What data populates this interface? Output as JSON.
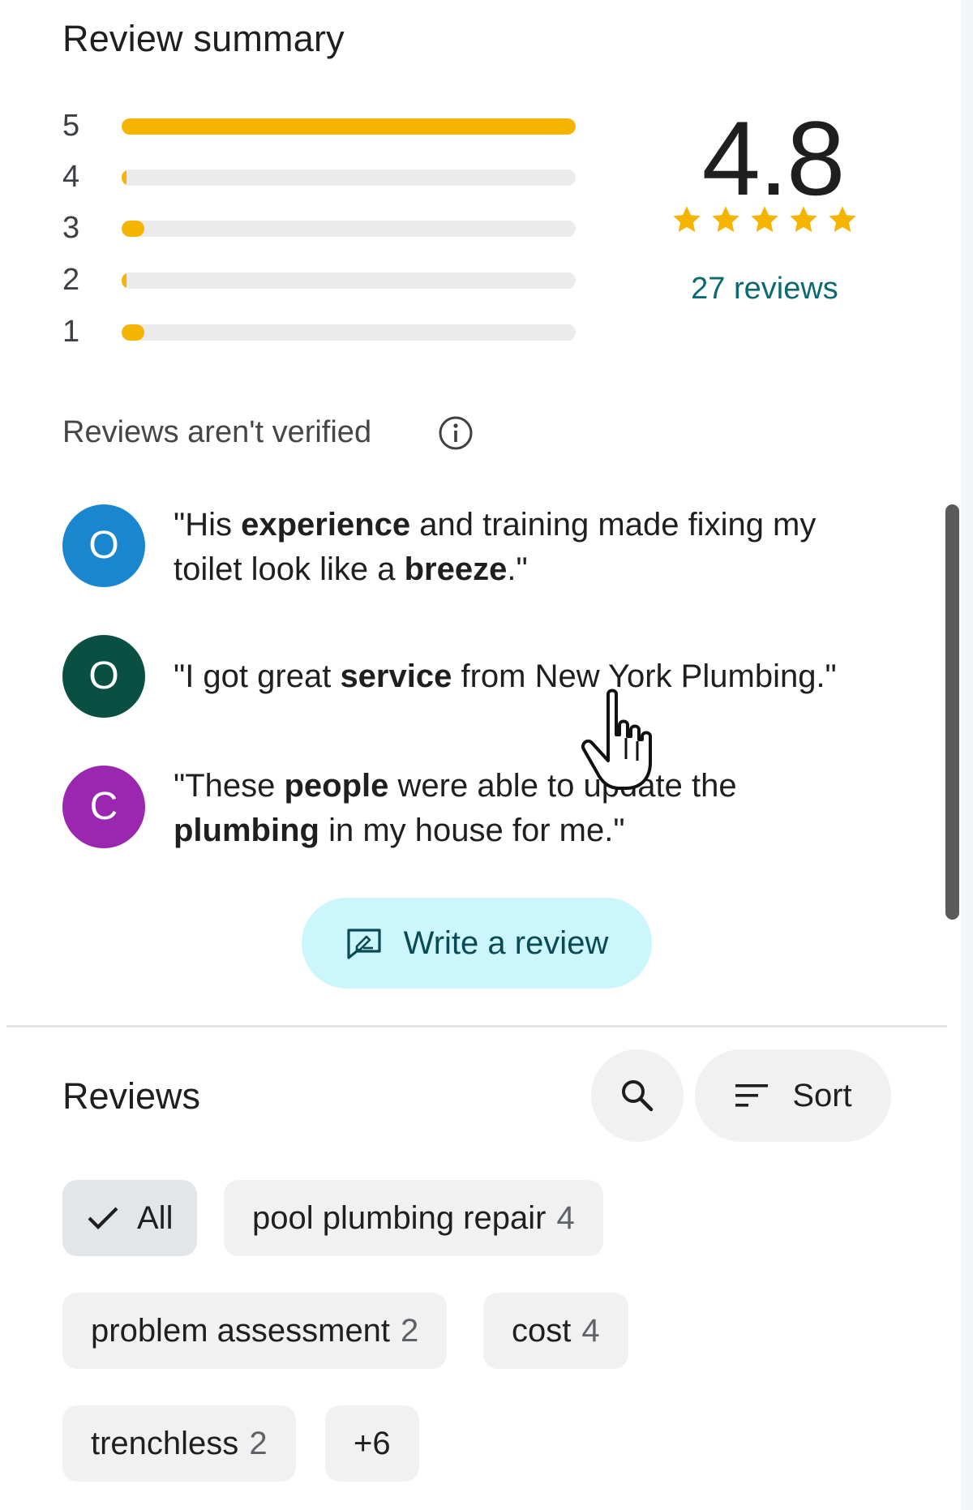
{
  "summary": {
    "title": "Review summary",
    "average": "4.8",
    "stars": 5,
    "review_count_label": "27 reviews",
    "star_color": "#f4b400",
    "histogram": [
      {
        "stars": "5",
        "fraction": 1.0
      },
      {
        "stars": "4",
        "fraction": 0.01
      },
      {
        "stars": "3",
        "fraction": 0.05
      },
      {
        "stars": "2",
        "fraction": 0.01
      },
      {
        "stars": "1",
        "fraction": 0.05
      }
    ],
    "unverified_text": "Reviews aren't verified"
  },
  "quotes": [
    {
      "avatar_letter": "O",
      "avatar_color": "#1a86d0",
      "parts": [
        {
          "text": "\"His ",
          "bold": false
        },
        {
          "text": "experience",
          "bold": true
        },
        {
          "text": " and training made fixing my toilet look like a ",
          "bold": false
        },
        {
          "text": "breeze",
          "bold": true
        },
        {
          "text": ".\"",
          "bold": false
        }
      ]
    },
    {
      "avatar_letter": "O",
      "avatar_color": "#0a5042",
      "parts": [
        {
          "text": "\"I got great ",
          "bold": false
        },
        {
          "text": "service",
          "bold": true
        },
        {
          "text": " from New York Plumbing.\"",
          "bold": false
        }
      ]
    },
    {
      "avatar_letter": "C",
      "avatar_color": "#9b27b0",
      "parts": [
        {
          "text": "\"These ",
          "bold": false
        },
        {
          "text": "people",
          "bold": true
        },
        {
          "text": " were able to update the ",
          "bold": false
        },
        {
          "text": "plumbing",
          "bold": true
        },
        {
          "text": " in my house for me.\"",
          "bold": false
        }
      ]
    }
  ],
  "write_review_label": "Write a review",
  "reviews": {
    "title": "Reviews",
    "sort_label": "Sort",
    "chips": [
      {
        "label": "All",
        "count": "",
        "selected": true
      },
      {
        "label": "pool plumbing repair",
        "count": "4",
        "selected": false
      },
      {
        "label": "problem assessment",
        "count": "2",
        "selected": false
      },
      {
        "label": "cost",
        "count": "4",
        "selected": false
      },
      {
        "label": "trenchless",
        "count": "2",
        "selected": false
      },
      {
        "label": "+6",
        "count": "",
        "selected": false
      }
    ]
  },
  "icons": {
    "info": "info-icon",
    "write": "edit-review-icon",
    "search": "search-icon",
    "sort": "sort-icon",
    "check": "check-icon",
    "cursor": "hand-pointer-icon"
  }
}
